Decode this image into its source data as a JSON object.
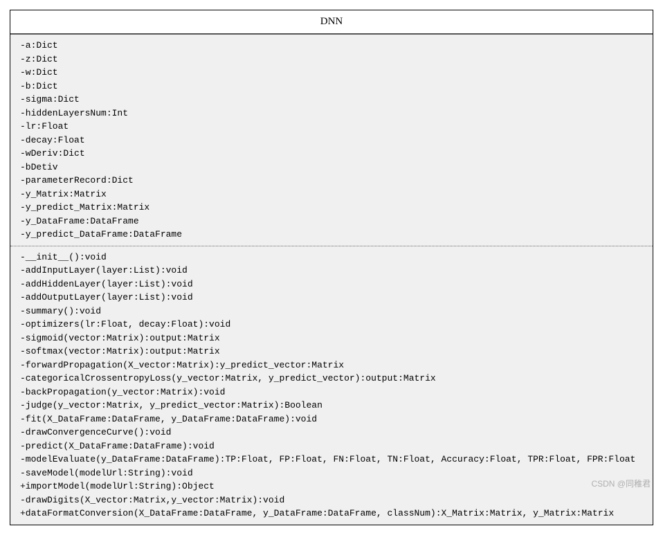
{
  "className": "DNN",
  "attributes": [
    "-a:Dict",
    "-z:Dict",
    "-w:Dict",
    "-b:Dict",
    "-sigma:Dict",
    "-hiddenLayersNum:Int",
    "-lr:Float",
    "-decay:Float",
    "-wDeriv:Dict",
    "-bDetiv",
    "-parameterRecord:Dict",
    "-y_Matrix:Matrix",
    "-y_predict_Matrix:Matrix",
    "-y_DataFrame:DataFrame",
    "-y_predict_DataFrame:DataFrame"
  ],
  "methods": [
    "-__init__():void",
    "-addInputLayer(layer:List):void",
    "-addHiddenLayer(layer:List):void",
    "-addOutputLayer(layer:List):void",
    "-summary():void",
    "-optimizers(lr:Float, decay:Float):void",
    "-sigmoid(vector:Matrix):output:Matrix",
    "-softmax(vector:Matrix):output:Matrix",
    "-forwardPropagation(X_vector:Matrix):y_predict_vector:Matrix",
    "-categoricalCrossentropyLoss(y_vector:Matrix, y_predict_vector):output:Matrix",
    "-backPropagation(y_vector:Matrix):void",
    "-judge(y_vector:Matrix, y_predict_vector:Matrix):Boolean",
    "-fit(X_DataFrame:DataFrame, y_DataFrame:DataFrame):void",
    "-drawConvergenceCurve():void",
    "-predict(X_DataFrame:DataFrame):void",
    "-modelEvaluate(y_DataFrame:DataFrame):TP:Float, FP:Float, FN:Float, TN:Float, Accuracy:Float, TPR:Float, FPR:Float",
    "-saveModel(modelUrl:String):void",
    "+importModel(modelUrl:String):Object",
    "-drawDigits(X_vector:Matrix,y_vector:Matrix):void",
    "+dataFormatConversion(X_DataFrame:DataFrame, y_DataFrame:DataFrame, classNum):X_Matrix:Matrix, y_Matrix:Matrix"
  ],
  "watermark": "CSDN @同稚君"
}
